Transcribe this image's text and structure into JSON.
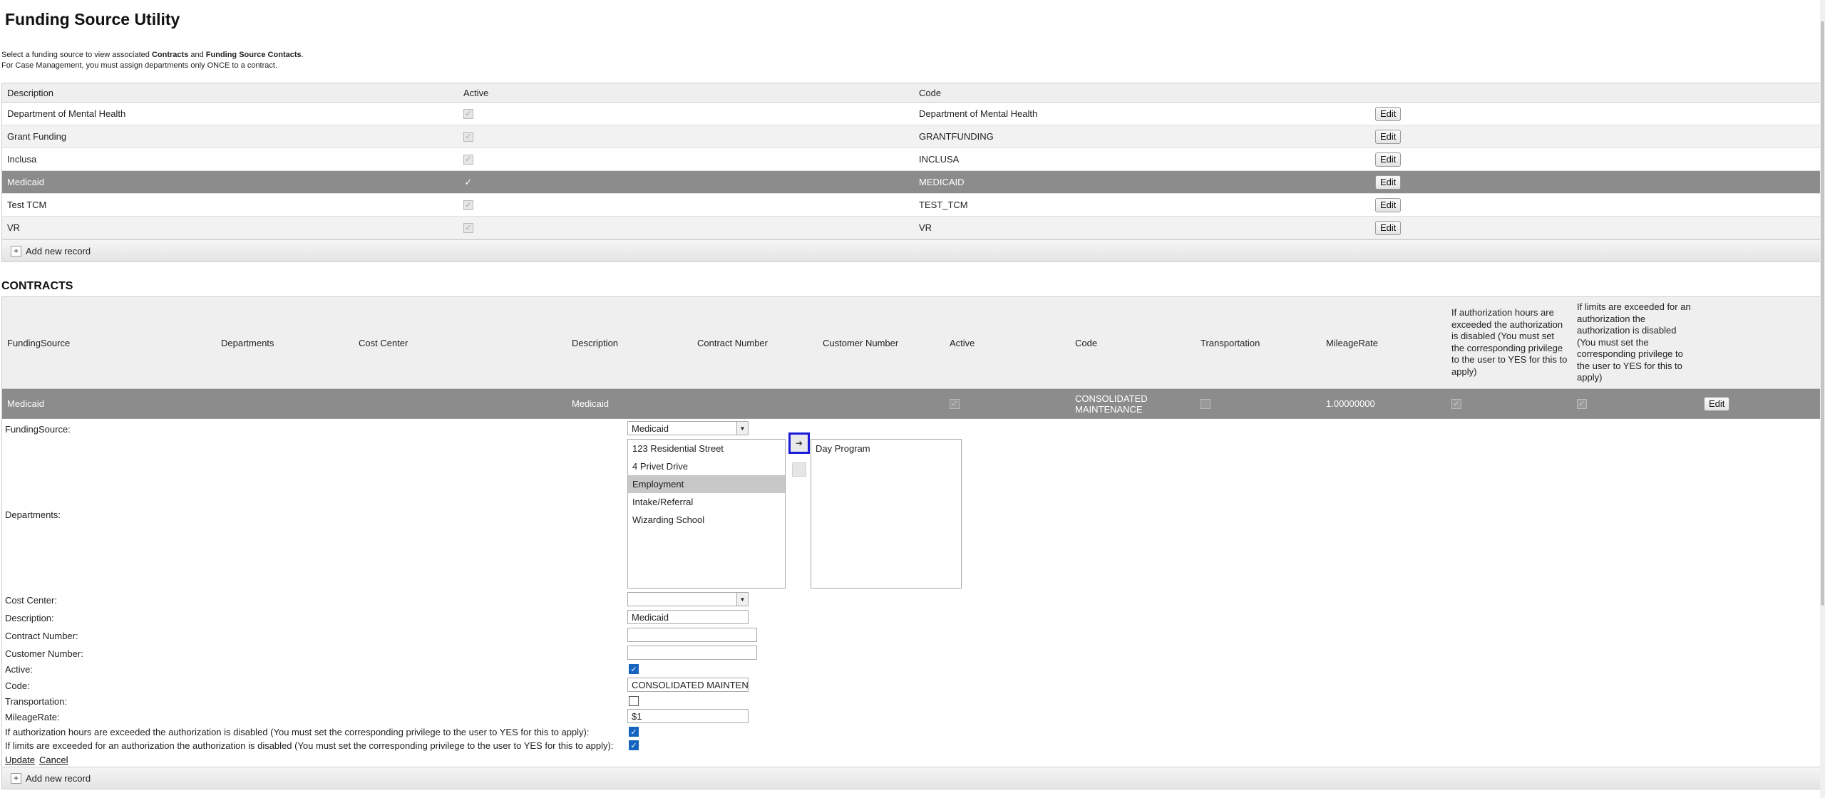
{
  "title": "Funding Source Utility",
  "intro": {
    "line1_pre": "Select a funding source to view associated ",
    "line1_b1": "Contracts",
    "line1_mid": " and ",
    "line1_b2": "Funding Source Contacts",
    "line1_post": ".",
    "line2": "For Case Management, you must assign departments only ONCE to a contract."
  },
  "funding_grid": {
    "headers": {
      "description": "Description",
      "active": "Active",
      "code": "Code"
    },
    "rows": [
      {
        "description": "Department of Mental Health",
        "active": true,
        "code": "Department of Mental Health",
        "edit": "Edit"
      },
      {
        "description": "Grant Funding",
        "active": true,
        "code": "GRANTFUNDING",
        "edit": "Edit"
      },
      {
        "description": "Inclusa",
        "active": true,
        "code": "INCLUSA",
        "edit": "Edit"
      },
      {
        "description": "Medicaid",
        "active": true,
        "code": "MEDICAID",
        "edit": "Edit",
        "selected": true
      },
      {
        "description": "Test TCM",
        "active": true,
        "code": "TEST_TCM",
        "edit": "Edit"
      },
      {
        "description": "VR",
        "active": true,
        "code": "VR",
        "edit": "Edit"
      }
    ],
    "add_label": "Add new record"
  },
  "contracts": {
    "heading": "CONTRACTS",
    "headers": {
      "funding_source": "FundingSource",
      "departments": "Departments",
      "cost_center": "Cost Center",
      "description": "Description",
      "contract_number": "Contract Number",
      "customer_number": "Customer Number",
      "active": "Active",
      "code": "Code",
      "transportation": "Transportation",
      "mileage_rate": "MileageRate",
      "auth_hours": "If authorization hours are exceeded the authorization is disabled (You must set the corresponding privilege to the user to YES for this to apply)",
      "limits": "If limits are exceeded for an authorization the authorization is disabled (You must set the corresponding privilege to the user to YES for this to apply)"
    },
    "row": {
      "funding_source": "Medicaid",
      "description": "Medicaid",
      "code": "CONSOLIDATED MAINTENANCE",
      "mileage_rate": "1.00000000",
      "edit": "Edit"
    },
    "form": {
      "labels": {
        "funding_source": "FundingSource:",
        "departments": "Departments:",
        "cost_center": "Cost Center:",
        "description": "Description:",
        "contract_number": "Contract Number:",
        "customer_number": "Customer Number:",
        "active": "Active:",
        "code": "Code:",
        "transportation": "Transportation:",
        "mileage_rate": "MileageRate:",
        "auth_hours": "If authorization hours are exceeded the authorization is disabled (You must set the corresponding privilege to the user to YES for this to apply):",
        "limits": "If limits are exceeded for an authorization the authorization is disabled (You must set the corresponding privilege to the user to YES for this to apply):"
      },
      "funding_source_value": "Medicaid",
      "available_departments": [
        "123 Residential Street",
        "4 Privet Drive",
        "Employment",
        "Intake/Referral",
        "Wizarding School"
      ],
      "selected_available": "Employment",
      "assigned_departments": [
        "Day Program"
      ],
      "cost_center_value": "",
      "description_value": "Medicaid",
      "contract_number_value": "",
      "customer_number_value": "",
      "active": true,
      "code_value": "CONSOLIDATED MAINTENANCE",
      "transportation": false,
      "mileage_rate_value": "$1",
      "auth_hours": true,
      "limits": true,
      "update_label": "Update",
      "cancel_label": "Cancel"
    },
    "add_label": "Add new record"
  }
}
